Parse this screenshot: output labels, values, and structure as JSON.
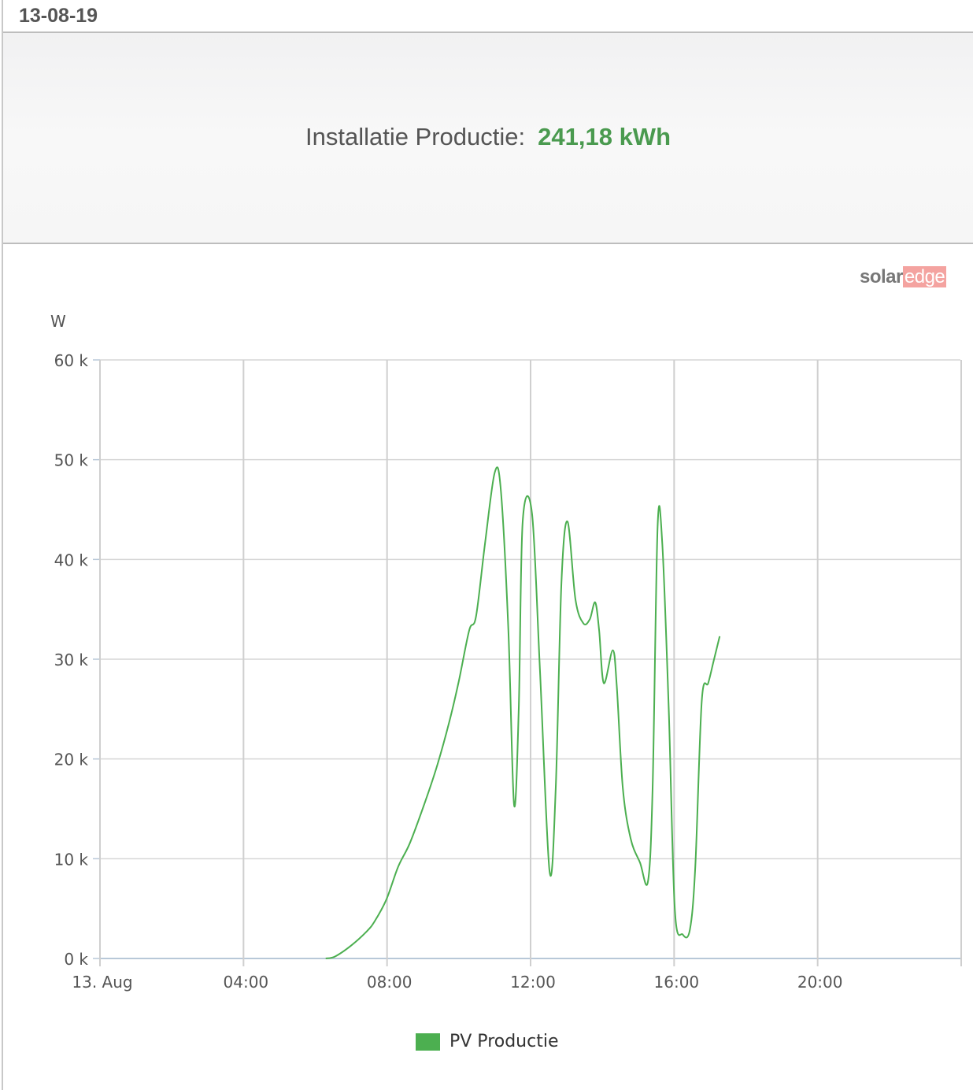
{
  "header": {
    "date": "13-08-19"
  },
  "summary": {
    "label": "Installatie Productie:",
    "value": "241,18 kWh"
  },
  "logo": {
    "part1": "solar",
    "part2": "edge"
  },
  "colors": {
    "series": "#4caf50",
    "value": "#4a9a4f"
  },
  "chart_data": {
    "type": "line",
    "title": "",
    "ylabel": "W",
    "xlabel": "",
    "xlim": [
      0,
      24
    ],
    "ylim": [
      0,
      60
    ],
    "x_ticks": [
      {
        "value": 0,
        "label": "13. Aug"
      },
      {
        "value": 4,
        "label": "04:00"
      },
      {
        "value": 8,
        "label": "08:00"
      },
      {
        "value": 12,
        "label": "12:00"
      },
      {
        "value": 16,
        "label": "16:00"
      },
      {
        "value": 20,
        "label": "20:00"
      }
    ],
    "y_ticks": [
      {
        "value": 0,
        "label": "0 k"
      },
      {
        "value": 10,
        "label": "10 k"
      },
      {
        "value": 20,
        "label": "20 k"
      },
      {
        "value": 30,
        "label": "30 k"
      },
      {
        "value": 40,
        "label": "40 k"
      },
      {
        "value": 50,
        "label": "50 k"
      },
      {
        "value": 60,
        "label": "60 k"
      }
    ],
    "grid": true,
    "legend": "bottom",
    "series": [
      {
        "name": "PV Productie",
        "x_unit": "hour",
        "y_unit": "kW",
        "points": [
          [
            6.29,
            0
          ],
          [
            6.55,
            0.2
          ],
          [
            7.0,
            1.3
          ],
          [
            7.43,
            2.7
          ],
          [
            7.65,
            3.7
          ],
          [
            7.98,
            5.9
          ],
          [
            8.31,
            9.2
          ],
          [
            8.64,
            11.6
          ],
          [
            9.08,
            15.9
          ],
          [
            9.41,
            19.5
          ],
          [
            9.74,
            23.8
          ],
          [
            10.0,
            27.8
          ],
          [
            10.29,
            32.9
          ],
          [
            10.48,
            34.3
          ],
          [
            10.73,
            41.6
          ],
          [
            11.0,
            48.7
          ],
          [
            11.17,
            47
          ],
          [
            11.38,
            33
          ],
          [
            11.54,
            15.4
          ],
          [
            11.67,
            25
          ],
          [
            11.78,
            43.8
          ],
          [
            12.04,
            44.6
          ],
          [
            12.26,
            29
          ],
          [
            12.53,
            8.7
          ],
          [
            12.7,
            17
          ],
          [
            12.86,
            37.7
          ],
          [
            13.03,
            43.8
          ],
          [
            13.25,
            36
          ],
          [
            13.47,
            33.6
          ],
          [
            13.65,
            34
          ],
          [
            13.8,
            35.7
          ],
          [
            13.91,
            32.9
          ],
          [
            14.04,
            27.6
          ],
          [
            14.29,
            30.9
          ],
          [
            14.4,
            27.4
          ],
          [
            14.57,
            17.1
          ],
          [
            14.79,
            12
          ],
          [
            15.05,
            9.6
          ],
          [
            15.27,
            7.7
          ],
          [
            15.4,
            17
          ],
          [
            15.54,
            43.3
          ],
          [
            15.67,
            41.6
          ],
          [
            15.85,
            25
          ],
          [
            16.02,
            4.9
          ],
          [
            16.24,
            2.4
          ],
          [
            16.44,
            2.9
          ],
          [
            16.59,
            9.2
          ],
          [
            16.77,
            25.8
          ],
          [
            16.95,
            27.6
          ],
          [
            17.1,
            29.8
          ],
          [
            17.27,
            32.3
          ]
        ]
      }
    ]
  }
}
